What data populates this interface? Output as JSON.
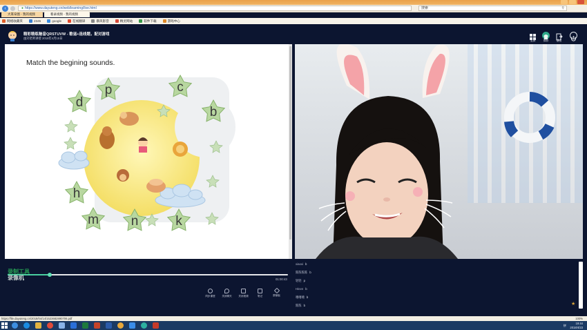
{
  "browser": {
    "url": "https://www.dayuteng.cn/web/learning/live.html",
    "search_placeholder": "搜索",
    "tabs": [
      {
        "label": "大耳朵图 - 我的视频"
      },
      {
        "label": "看录视频 - 我的视频"
      },
      {
        "label": "看录视频 - 分享平台"
      }
    ],
    "bookmarks": [
      "网络收藏夹",
      "2345",
      "google",
      "在线翻译",
      "暴风影音",
      "精灵网站",
      "软件下载",
      "游戏中心"
    ],
    "status_url": "https://file.dayuteng.cn/2018/04/14/1523682890706.pdf",
    "zoom": "100%",
    "colors": {
      "titlebar": "#eaa14a",
      "app_bg": "#0c1530",
      "accent": "#4ad0a0"
    }
  },
  "app": {
    "title": "精彩精练魅音QRSTUVW - 歌谣+连线题，配对游戏",
    "subtitle": "由刘老师讲授 2018年4月15日",
    "header_icons": [
      {
        "name": "grid-icon",
        "label": "全屏"
      },
      {
        "name": "shirt-icon",
        "label": "换肤"
      },
      {
        "name": "exit-doc-icon",
        "label": "退出"
      },
      {
        "name": "power-icon",
        "label": ""
      }
    ]
  },
  "slide": {
    "title": "Match the begining sounds.",
    "letters": [
      "p",
      "c",
      "d",
      "b",
      "h",
      "m",
      "n",
      "k"
    ]
  },
  "player": {
    "progress": 0.15,
    "time": "01:00:43",
    "watermark_line1": "录制工具",
    "watermark_line2": "录像机",
    "toolbar": [
      {
        "name": "sync-icon",
        "label": "同步课堂"
      },
      {
        "name": "bubble-icon",
        "label": "关闭聊天"
      },
      {
        "name": "close-video-icon",
        "label": "关闭视频"
      },
      {
        "name": "note-icon",
        "label": "笔记"
      },
      {
        "name": "hide-icon",
        "label": "屏蔽板"
      }
    ]
  },
  "chat": {
    "messages": [
      {
        "user": "xiaoxi",
        "text": "b"
      },
      {
        "user": "陈陈陈陈",
        "text": "b"
      },
      {
        "user": "轻轻",
        "text": "p"
      },
      {
        "user": "Hinen",
        "text": "b"
      },
      {
        "user": "嘻嘻嘻",
        "text": "b"
      },
      {
        "user": "陈陈",
        "text": "b"
      }
    ]
  },
  "taskbar": {
    "time": "19:44",
    "date": "2018/4/23",
    "tray": "拼"
  }
}
